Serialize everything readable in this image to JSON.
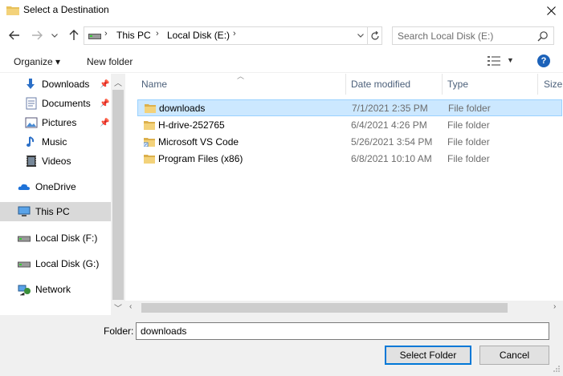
{
  "window": {
    "title": "Select a Destination"
  },
  "address": {
    "segments": [
      "This PC",
      "Local Disk (E:)"
    ]
  },
  "search": {
    "placeholder": "Search Local Disk (E:)"
  },
  "toolbar": {
    "organize_label": "Organize",
    "new_folder_label": "New folder"
  },
  "sidebar": {
    "items": [
      {
        "label": "Downloads",
        "icon": "download-arrow-icon",
        "pinned": true
      },
      {
        "label": "Documents",
        "icon": "documents-icon",
        "pinned": true
      },
      {
        "label": "Pictures",
        "icon": "pictures-icon",
        "pinned": true
      },
      {
        "label": "Music",
        "icon": "music-note-icon",
        "pinned": false
      },
      {
        "label": "Videos",
        "icon": "videos-icon",
        "pinned": false
      },
      {
        "label": "OneDrive",
        "icon": "cloud-icon",
        "pinned": false
      },
      {
        "label": "This PC",
        "icon": "computer-icon",
        "pinned": false,
        "selected": true
      },
      {
        "label": "Local Disk (F:)",
        "icon": "drive-icon",
        "pinned": false
      },
      {
        "label": "Local Disk (G:)",
        "icon": "drive-icon",
        "pinned": false
      },
      {
        "label": "Network",
        "icon": "network-icon",
        "pinned": false
      }
    ]
  },
  "columns": {
    "name": "Name",
    "date": "Date modified",
    "type": "Type",
    "size": "Size"
  },
  "files": [
    {
      "name": "downloads",
      "date": "7/1/2021 2:35 PM",
      "type": "File folder",
      "selected": true,
      "icon": "folder-icon"
    },
    {
      "name": "H-drive-252765",
      "date": "6/4/2021 4:26 PM",
      "type": "File folder",
      "icon": "folder-icon"
    },
    {
      "name": "Microsoft VS Code",
      "date": "5/26/2021 3:54 PM",
      "type": "File folder",
      "icon": "folder-shortcut-icon"
    },
    {
      "name": "Program Files (x86)",
      "date": "6/8/2021 10:10 AM",
      "type": "File folder",
      "icon": "folder-icon"
    }
  ],
  "footer": {
    "folder_label": "Folder:",
    "folder_value": "downloads",
    "select_label": "Select Folder",
    "cancel_label": "Cancel"
  },
  "colors": {
    "selection": "#cce8ff",
    "selection_border": "#99d1ff",
    "accent": "#0078d7",
    "folder": "#e8c15a"
  }
}
